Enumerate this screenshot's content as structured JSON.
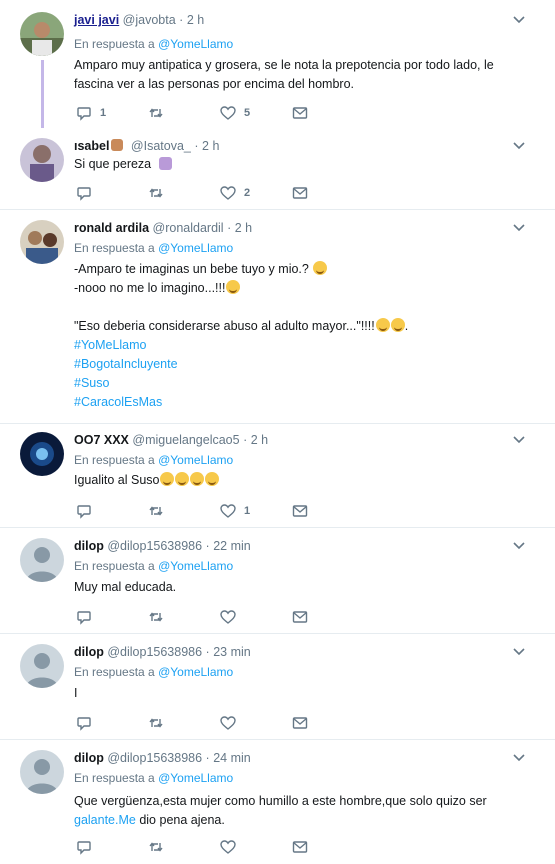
{
  "tweets": [
    {
      "name": "javi javi",
      "handle": "@javobta",
      "dot": "·",
      "time": "2 h",
      "reply_label": "En respuesta a",
      "reply_to": "@YomeLlamo",
      "text": "Amparo muy antipatica y grosera, se le nota la prepotencia por todo lado, le fascina ver a las personas por encima del hombro.",
      "reply_count": "1",
      "retweet_count": "",
      "like_count": "5"
    },
    {
      "name": "ısabel",
      "handle": "@Isatova_",
      "dot": "·",
      "time": "2 h",
      "text": "Si que pereza",
      "reply_count": "",
      "retweet_count": "",
      "like_count": "2"
    },
    {
      "name": "ronald ardila",
      "handle": "@ronaldardil",
      "dot": "·",
      "time": "2 h",
      "reply_label": "En respuesta a",
      "reply_to": "@YomeLlamo",
      "line1": "-Amparo te imaginas un bebe tuyo y mio.?",
      "line2": "-nooo no me lo imagino...!!!",
      "line3": "\"Eso deberia considerarse abuso al adulto mayor...\"!!!!",
      "tags": [
        "#YoMeLlamo",
        "#BogotaIncluyente",
        "#Suso",
        "#CaracolEsMas"
      ]
    },
    {
      "name": "OO7 XXX",
      "handle": "@miguelangelcao5",
      "dot": "·",
      "time": "2 h",
      "reply_label": "En respuesta a",
      "reply_to": "@YomeLlamo",
      "text": "Igualito al Suso",
      "reply_count": "",
      "retweet_count": "",
      "like_count": "1"
    },
    {
      "name": "dilop",
      "handle": "@dilop15638986",
      "dot": "·",
      "time": "22 min",
      "reply_label": "En respuesta a",
      "reply_to": "@YomeLlamo",
      "text": "Muy mal educada."
    },
    {
      "name": "dilop",
      "handle": "@dilop15638986",
      "dot": "·",
      "time": "23 min",
      "reply_label": "En respuesta a",
      "reply_to": "@YomeLlamo",
      "text": "I"
    },
    {
      "name": "dilop",
      "handle": "@dilop15638986",
      "dot": "·",
      "time": "24 min",
      "reply_label": "En respuesta a",
      "reply_to": "@YomeLlamo",
      "text_a": "Que vergüenza,esta mujer como humillo a este hombre,que solo quizo ser ",
      "text_link": "galante.Me",
      "text_b": " dio pena ajena."
    }
  ],
  "colors": {
    "link": "#1da1f2",
    "muted": "#657786",
    "thread_line": "#c4b7e8"
  }
}
